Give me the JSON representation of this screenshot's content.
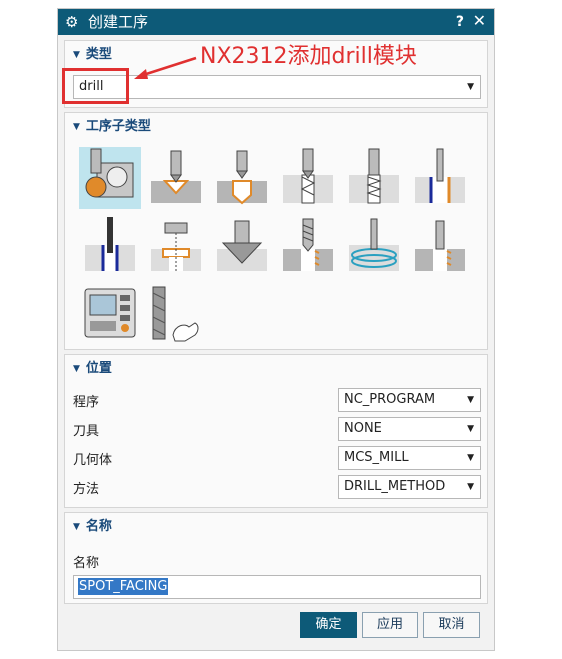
{
  "titlebar": {
    "title": "创建工序",
    "help": "?",
    "close": "✕"
  },
  "annotation": {
    "text": "NX2312添加drill模块",
    "color": "#e03030"
  },
  "type_section": {
    "header": "类型",
    "selected": "drill"
  },
  "subtype_section": {
    "header": "工序子类型",
    "icons": [
      "drill-on-part-icon",
      "spot-drilling-icon",
      "drilling-icon",
      "deep-hole-drilling-icon",
      "breakchip-drilling-icon",
      "boring-icon",
      "reaming-icon",
      "counterboring-icon",
      "countersinking-icon",
      "tapping-icon",
      "thread-milling-icon",
      "hole-making-icon",
      "machine-control-icon",
      "user-defined-operation-icon"
    ],
    "selected_index": 0
  },
  "location_section": {
    "header": "位置",
    "rows": [
      {
        "label": "程序",
        "value": "NC_PROGRAM"
      },
      {
        "label": "刀具",
        "value": "NONE"
      },
      {
        "label": "几何体",
        "value": "MCS_MILL"
      },
      {
        "label": "方法",
        "value": "DRILL_METHOD"
      }
    ]
  },
  "name_section": {
    "header": "名称",
    "label": "名称",
    "value": "SPOT_FACING"
  },
  "buttons": {
    "ok": "确定",
    "apply": "应用",
    "cancel": "取消"
  },
  "colors": {
    "titlebar": "#0d5a78",
    "accent_text": "#1a4a7a",
    "annotation": "#e03030",
    "selection": "#bfe4ee"
  }
}
